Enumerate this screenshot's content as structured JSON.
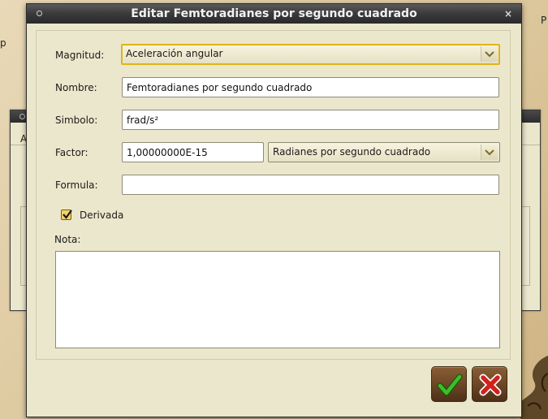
{
  "background": {
    "left_glyph": "p",
    "right_glyph": "P",
    "window_letter": "A"
  },
  "dialog": {
    "title": "Editar Femtoradianes por segundo cuadrado",
    "close_glyph": "×"
  },
  "form": {
    "magnitud_label": "Magnitud:",
    "magnitud_value": "Aceleración angular",
    "nombre_label": "Nombre:",
    "nombre_value": "Femtoradianes por segundo cuadrado",
    "simbolo_label": "Simbolo:",
    "simbolo_value": "frad/s²",
    "factor_label": "Factor:",
    "factor_value": "1,00000000E-15",
    "factor_unit_value": "Radianes por segundo cuadrado",
    "formula_label": "Formula:",
    "formula_value": "",
    "derivada_label": "Derivada",
    "derivada_checked": true,
    "nota_label": "Nota:",
    "nota_value": ""
  },
  "buttons": {
    "accept_icon": "green-check-icon",
    "cancel_icon": "red-x-icon"
  },
  "colors": {
    "dialog_bg": "#ebe7cc",
    "titlebar": "#3a3a3a",
    "focus_border": "#e0b41a",
    "check_green": "#2f9a1e",
    "cancel_red": "#d1211b",
    "button_brown": "#6a4524"
  }
}
